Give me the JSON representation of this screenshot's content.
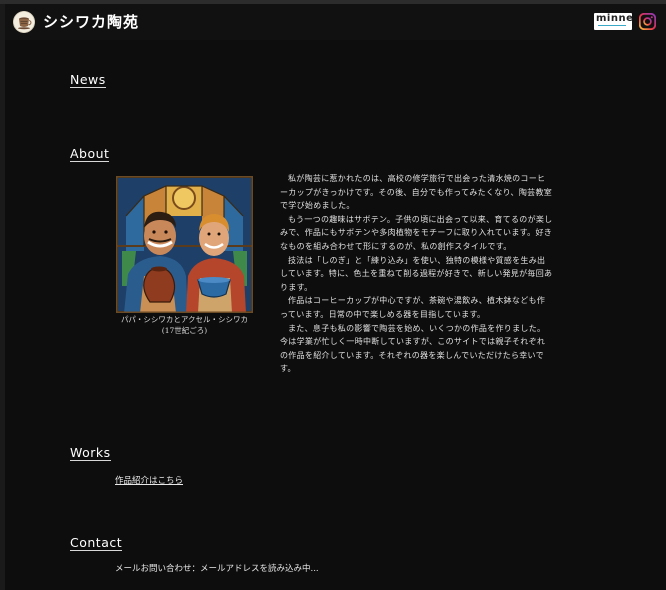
{
  "header": {
    "site_title": "シシワカ陶苑",
    "minne_label": "minne",
    "instagram_icon": "instagram-icon",
    "logo_icon": "coffee-cup-logo-icon"
  },
  "sections": {
    "news": {
      "heading": "News"
    },
    "about": {
      "heading": "About",
      "image_caption_line1": "パパ・シシワカとアクセル・シシワカ",
      "image_caption_line2": "(17世紀ごろ)",
      "paragraphs": [
        "私が陶芸に惹かれたのは、高校の修学旅行で出会った清水焼のコーヒーカップがきっかけです。その後、自分でも作ってみたくなり、陶芸教室で学び始めました。",
        "もう一つの趣味はサボテン。子供の頃に出会って以来、育てるのが楽しみで、作品にもサボテンや多肉植物をモチーフに取り入れています。好きなものを組み合わせて形にするのが、私の創作スタイルです。",
        "技法は「しのぎ」と「練り込み」を使い、独特の模様や質感を生み出しています。特に、色土を重ねて削る過程が好きで、新しい発見が毎回あります。",
        "作品はコーヒーカップが中心ですが、茶碗や湯飲み、植木鉢なども作っています。日常の中で楽しめる器を目指しています。",
        "また、息子も私の影響で陶芸を始め、いくつかの作品を作りました。今は学業が忙しく一時中断していますが、このサイトでは親子それぞれの作品を紹介しています。それぞれの器を楽しんでいただけたら幸いです。"
      ]
    },
    "works": {
      "heading": "Works",
      "link_text": "作品紹介はこちら"
    },
    "contact": {
      "heading": "Contact",
      "text": "メールお問い合わせ：メールアドレスを読み込み中..."
    }
  }
}
